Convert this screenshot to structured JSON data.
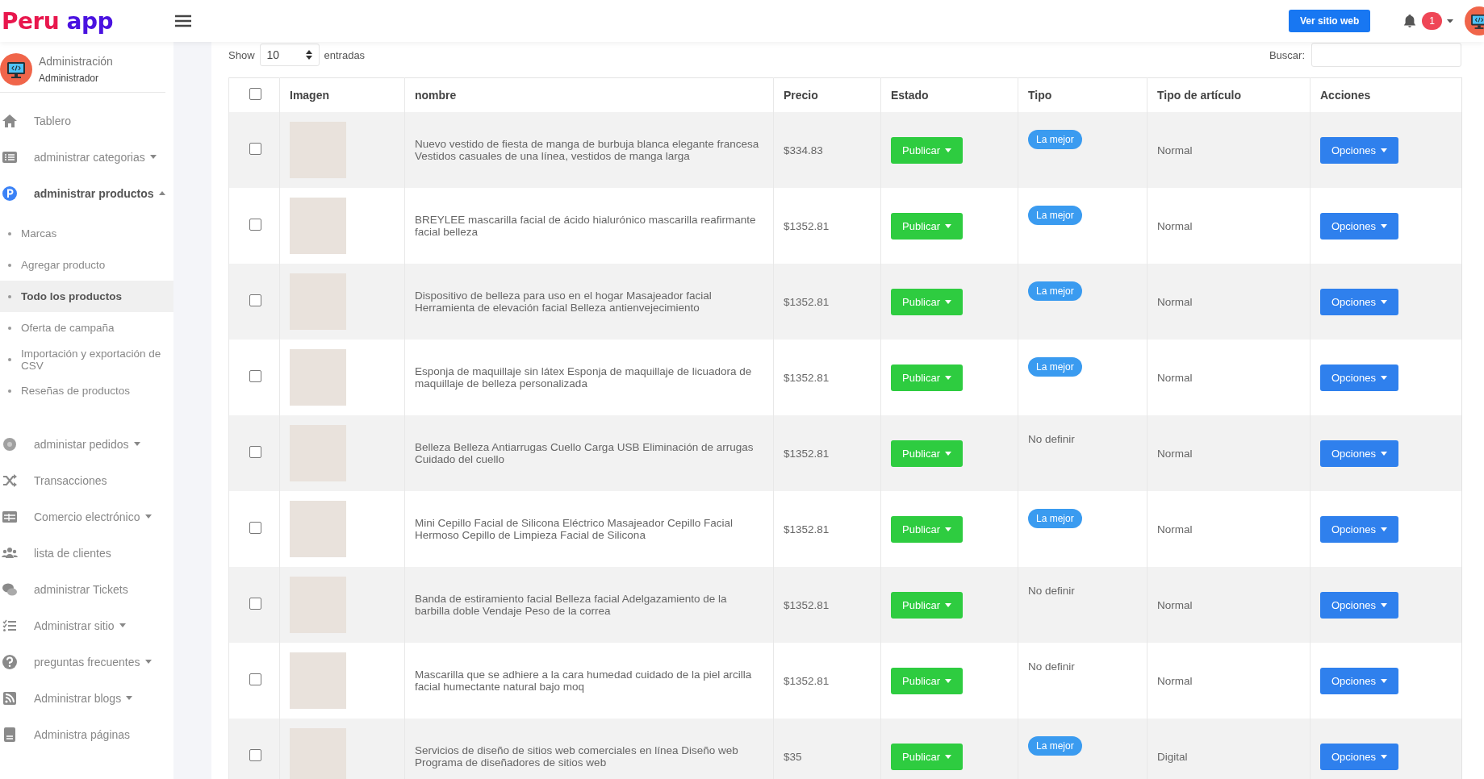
{
  "header": {
    "logo": [
      "Peru",
      "app"
    ],
    "view_site_button": "Ver sitio web",
    "notification_count": "1"
  },
  "sidebar": {
    "profile": {
      "title": "Administración",
      "role": "Administrador"
    },
    "items": [
      {
        "label": "Tablero",
        "kind": "link"
      },
      {
        "label": "administrar categorias",
        "kind": "dropdown",
        "expanded": false
      },
      {
        "label": "administrar productos",
        "kind": "dropdown",
        "expanded": true,
        "children": [
          {
            "label": "Marcas",
            "selected": false
          },
          {
            "label": "Agregar producto",
            "selected": false
          },
          {
            "label": "Todo los productos",
            "selected": true
          },
          {
            "label": "Oferta de campaña",
            "selected": false
          },
          {
            "label": "Importación y exportación de CSV",
            "selected": false
          },
          {
            "label": "Reseñas de productos",
            "selected": false
          }
        ]
      },
      {
        "label": "administar pedidos",
        "kind": "dropdown",
        "expanded": false
      },
      {
        "label": "Transacciones",
        "kind": "link"
      },
      {
        "label": "Comercio electrónico",
        "kind": "dropdown",
        "expanded": false
      },
      {
        "label": "lista de clientes",
        "kind": "link"
      },
      {
        "label": "administrar Tickets",
        "kind": "link"
      },
      {
        "label": "Administrar sitio",
        "kind": "dropdown",
        "expanded": false
      },
      {
        "label": "preguntas frecuentes",
        "kind": "dropdown",
        "expanded": false
      },
      {
        "label": "Administrar blogs",
        "kind": "dropdown",
        "expanded": false
      },
      {
        "label": "Administra páginas",
        "kind": "link"
      }
    ]
  },
  "table_controls": {
    "show_label": "Show",
    "page_size": "10",
    "entries_label": "entradas",
    "search_label": "Buscar:"
  },
  "table": {
    "select_all_checked": false,
    "columns": [
      "Imagen",
      "nombre",
      "Precio",
      "Estado",
      "Tipo",
      "Tipo de artículo",
      "Acciones"
    ],
    "rows": [
      {
        "checked": false,
        "name": "Nuevo vestido de fiesta de manga de burbuja blanca elegante francesa Vestidos casuales de una línea, vestidos de manga larga",
        "price": "$334.83",
        "status": "Publicar",
        "type": {
          "kind": "badge",
          "text": "La mejor"
        },
        "item_type": "Normal",
        "action": "Opciones"
      },
      {
        "checked": false,
        "name": "BREYLEE mascarilla facial de ácido hialurónico mascarilla reafirmante facial belleza",
        "price": "$1352.81",
        "status": "Publicar",
        "type": {
          "kind": "badge",
          "text": "La mejor"
        },
        "item_type": "Normal",
        "action": "Opciones"
      },
      {
        "checked": false,
        "name": "Dispositivo de belleza para uso en el hogar Masajeador facial Herramienta de elevación facial Belleza antienvejecimiento",
        "price": "$1352.81",
        "status": "Publicar",
        "type": {
          "kind": "badge",
          "text": "La mejor"
        },
        "item_type": "Normal",
        "action": "Opciones"
      },
      {
        "checked": false,
        "name": "Esponja de maquillaje sin látex Esponja de maquillaje de licuadora de maquillaje de belleza personalizada",
        "price": "$1352.81",
        "status": "Publicar",
        "type": {
          "kind": "badge",
          "text": "La mejor"
        },
        "item_type": "Normal",
        "action": "Opciones"
      },
      {
        "checked": false,
        "name": "Belleza Belleza Antiarrugas Cuello Carga USB Eliminación de arrugas Cuidado del cuello",
        "price": "$1352.81",
        "status": "Publicar",
        "type": {
          "kind": "text",
          "text": "No definir"
        },
        "item_type": "Normal",
        "action": "Opciones"
      },
      {
        "checked": false,
        "name": "Mini Cepillo Facial de Silicona Eléctrico Masajeador Cepillo Facial Hermoso Cepillo de Limpieza Facial de Silicona",
        "price": "$1352.81",
        "status": "Publicar",
        "type": {
          "kind": "badge",
          "text": "La mejor"
        },
        "item_type": "Normal",
        "action": "Opciones"
      },
      {
        "checked": false,
        "name": "Banda de estiramiento facial Belleza facial Adelgazamiento de la barbilla doble Vendaje Peso de la correa",
        "price": "$1352.81",
        "status": "Publicar",
        "type": {
          "kind": "text",
          "text": "No definir"
        },
        "item_type": "Normal",
        "action": "Opciones"
      },
      {
        "checked": false,
        "name": "Mascarilla que se adhiere a la cara humedad cuidado de la piel arcilla facial humectante natural bajo moq",
        "price": "$1352.81",
        "status": "Publicar",
        "type": {
          "kind": "text",
          "text": "No definir"
        },
        "item_type": "Normal",
        "action": "Opciones"
      },
      {
        "checked": false,
        "name": "Servicios de diseño de sitios web comerciales en línea Diseño web Programa de diseñadores de sitios web",
        "price": "$35",
        "status": "Publicar",
        "type": {
          "kind": "badge",
          "text": "La mejor"
        },
        "item_type": "Digital",
        "action": "Opciones"
      }
    ]
  }
}
